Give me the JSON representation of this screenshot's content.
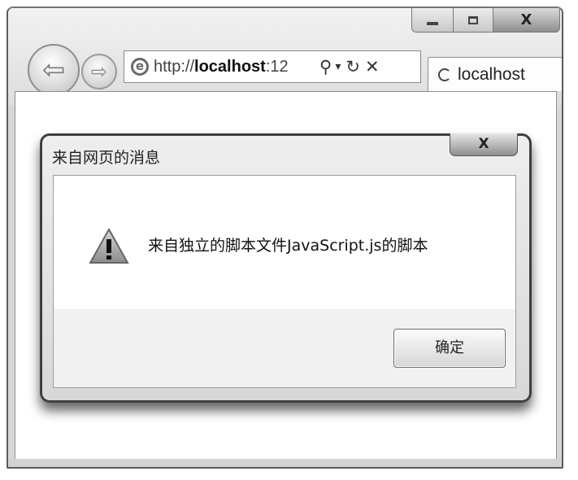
{
  "browser": {
    "window_controls": {
      "minimize_icon": "minimize-icon",
      "maximize_icon": "maximize-icon",
      "close_label": "X"
    },
    "nav": {
      "back_glyph": "⇦",
      "forward_glyph": "⇨"
    },
    "address": {
      "scheme": "http://",
      "host": "localhost",
      "rest": ":12",
      "search_glyph": "⚲",
      "dropdown_glyph": "▾",
      "refresh_glyph": "↻",
      "stop_glyph": "✕"
    },
    "tab": {
      "label": "localhost"
    }
  },
  "dialog": {
    "title": "来自网页的消息",
    "close_label": "X",
    "message": "来自独立的脚本文件JavaScript.js的脚本",
    "ok_label": "确定",
    "icon": "warning-icon"
  },
  "colors": {
    "window_frame": "#5b5b5b",
    "dialog_border": "#3f3f3f",
    "button_area": "#f1f1f1"
  }
}
